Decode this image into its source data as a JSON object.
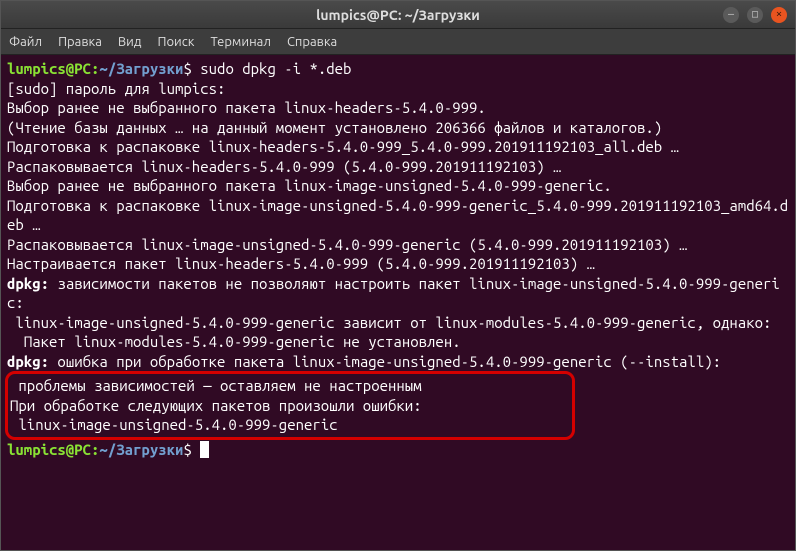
{
  "window": {
    "title": "lumpics@PC: ~/Загрузки"
  },
  "menu": {
    "file": "Файл",
    "edit": "Правка",
    "view": "Вид",
    "search": "Поиск",
    "terminal": "Терминал",
    "help": "Справка"
  },
  "prompt": {
    "user": "lumpics@PC",
    "colon": ":",
    "path": "~/Загрузки",
    "dollar": "$"
  },
  "command1": "sudo dpkg -i *.deb",
  "output": {
    "l1": "[sudo] пароль для lumpics:",
    "l2": "Выбор ранее не выбранного пакета linux-headers-5.4.0-999.",
    "l3": "(Чтение базы данных … на данный момент установлено 206366 файлов и каталогов.)",
    "l4": "Подготовка к распаковке linux-headers-5.4.0-999_5.4.0-999.201911192103_all.deb …",
    "l5": "Распаковывается linux-headers-5.4.0-999 (5.4.0-999.201911192103) …",
    "l6": "Выбор ранее не выбранного пакета linux-image-unsigned-5.4.0-999-generic.",
    "l7": "Подготовка к распаковке linux-image-unsigned-5.4.0-999-generic_5.4.0-999.201911192103_amd64.deb …",
    "l8": "Распаковывается linux-image-unsigned-5.4.0-999-generic (5.4.0-999.201911192103) …",
    "l9": "Настраивается пакет linux-headers-5.4.0-999 (5.4.0-999.201911192103) …",
    "l10a": "dpkg:",
    "l10b": " зависимости пакетов не позволяют настроить пакет linux-image-unsigned-5.4.0-999-generic:",
    "l11": " linux-image-unsigned-5.4.0-999-generic зависит от linux-modules-5.4.0-999-generic, однако:",
    "l12": "  Пакет linux-modules-5.4.0-999-generic не установлен.",
    "l13": "",
    "l14a": "dpkg:",
    "l14b": " ошибка при обработке пакета linux-image-unsigned-5.4.0-999-generic (--install):",
    "l15": " проблемы зависимостей — оставляем не настроенным",
    "l16": "При обработке следующих пакетов произошли ошибки:",
    "l17": " linux-image-unsigned-5.4.0-999-generic"
  }
}
